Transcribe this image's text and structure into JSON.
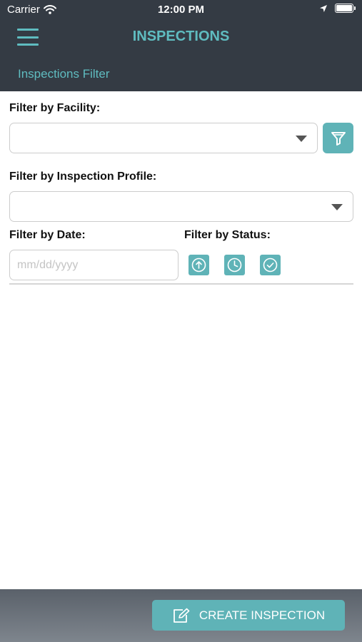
{
  "status_bar": {
    "carrier": "Carrier",
    "time": "12:00 PM"
  },
  "header": {
    "title": "INSPECTIONS",
    "menu_icon": "hamburger-menu-icon"
  },
  "subheader": {
    "title": "Inspections Filter"
  },
  "filters": {
    "facility_label": "Filter by Facility:",
    "facility_value": "",
    "profile_label": "Filter by Inspection Profile:",
    "profile_value": "",
    "date_label": "Filter by Date:",
    "date_placeholder": "mm/dd/yyyy",
    "status_label": "Filter by Status:",
    "status_buttons": [
      "upload-icon",
      "clock-icon",
      "check-circle-icon"
    ]
  },
  "footer": {
    "create_label": "CREATE INSPECTION"
  },
  "colors": {
    "accent": "#5fb3b7",
    "header_bg": "#343b44",
    "title": "#5fbcc0"
  }
}
